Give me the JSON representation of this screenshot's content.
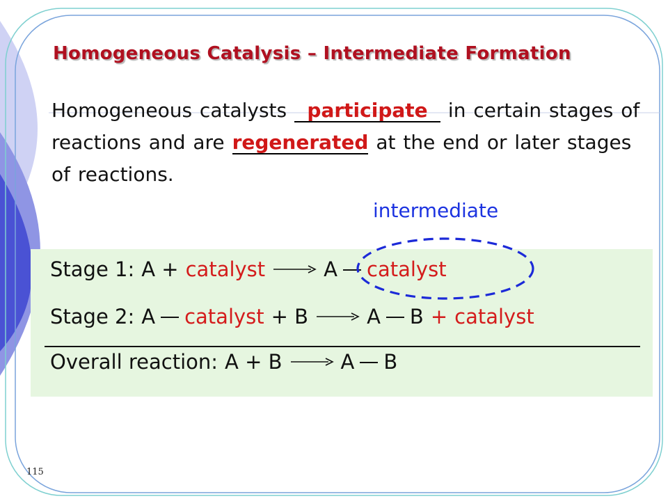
{
  "slide": {
    "title": "Homogeneous Catalysis – Intermediate Formation",
    "body": {
      "part1": "Homogeneous catalysts ",
      "blank1": "participate",
      "part2": " in certain stages of reactions and are ",
      "blank2": "regenerated",
      "part3": " at the end or later stages of reactions."
    },
    "intermediate_label": "intermediate",
    "stage1": {
      "label": "Stage 1:",
      "reactant": "A +",
      "catalyst": "catalyst",
      "product_a": "A",
      "product_catalyst": "catalyst"
    },
    "stage2": {
      "label": "Stage 2:",
      "reactant_a": "A",
      "catalyst": "catalyst",
      "plus_b": "+ B",
      "product_a": "A",
      "product_b": "B",
      "plus": "+",
      "product_catalyst": "catalyst"
    },
    "overall": {
      "label": "Overall reaction:",
      "reactants": "A + B",
      "product_a": "A",
      "product_b": "B"
    },
    "page_number": "115",
    "colors": {
      "title": "#b01020",
      "catalyst": "#d41c1c",
      "intermediate": "#1c33e0",
      "panel": "#e6f6e0"
    }
  }
}
